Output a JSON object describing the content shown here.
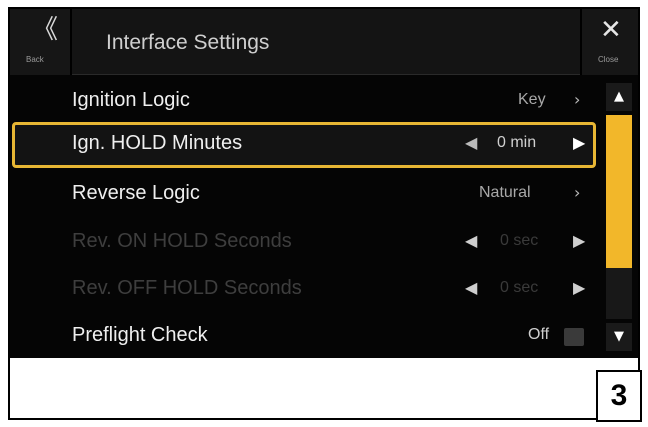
{
  "header": {
    "back_icon": "double-chevron-left-icon",
    "back_label": "Back",
    "title": "Interface Settings",
    "close_icon": "close-x-icon",
    "close_label": "Close"
  },
  "rows": [
    {
      "label": "Ignition Logic",
      "value": "Key",
      "right_icon": "chevron-right-icon",
      "right_glyph": "›",
      "enabled": true
    },
    {
      "label": "Ign. HOLD Minutes",
      "value": "0 min",
      "left_glyph": "◀",
      "right_glyph": "▶",
      "left_icon": "triangle-left-icon",
      "right_icon": "triangle-right-icon",
      "enabled": true,
      "selected": true
    },
    {
      "label": "Reverse Logic",
      "value": "Natural",
      "right_icon": "chevron-right-icon",
      "right_glyph": "›",
      "enabled": true
    },
    {
      "label": "Rev. ON HOLD Seconds",
      "value": "0 sec",
      "left_glyph": "◀",
      "right_glyph": "▶",
      "enabled": false
    },
    {
      "label": "Rev. OFF HOLD Seconds",
      "value": "0 sec",
      "left_glyph": "◀",
      "right_glyph": "▶",
      "enabled": false
    },
    {
      "label": "Preflight Check",
      "value": "Off",
      "enabled": true
    }
  ],
  "scrollbar": {
    "up_glyph": "▲",
    "down_glyph": "▼",
    "position_fraction": 0.0,
    "visible_fraction": 0.75
  },
  "step_number": "3",
  "colors": {
    "accent": "#e7b634",
    "scroll_thumb": "#f2b72a",
    "background": "#050505"
  }
}
